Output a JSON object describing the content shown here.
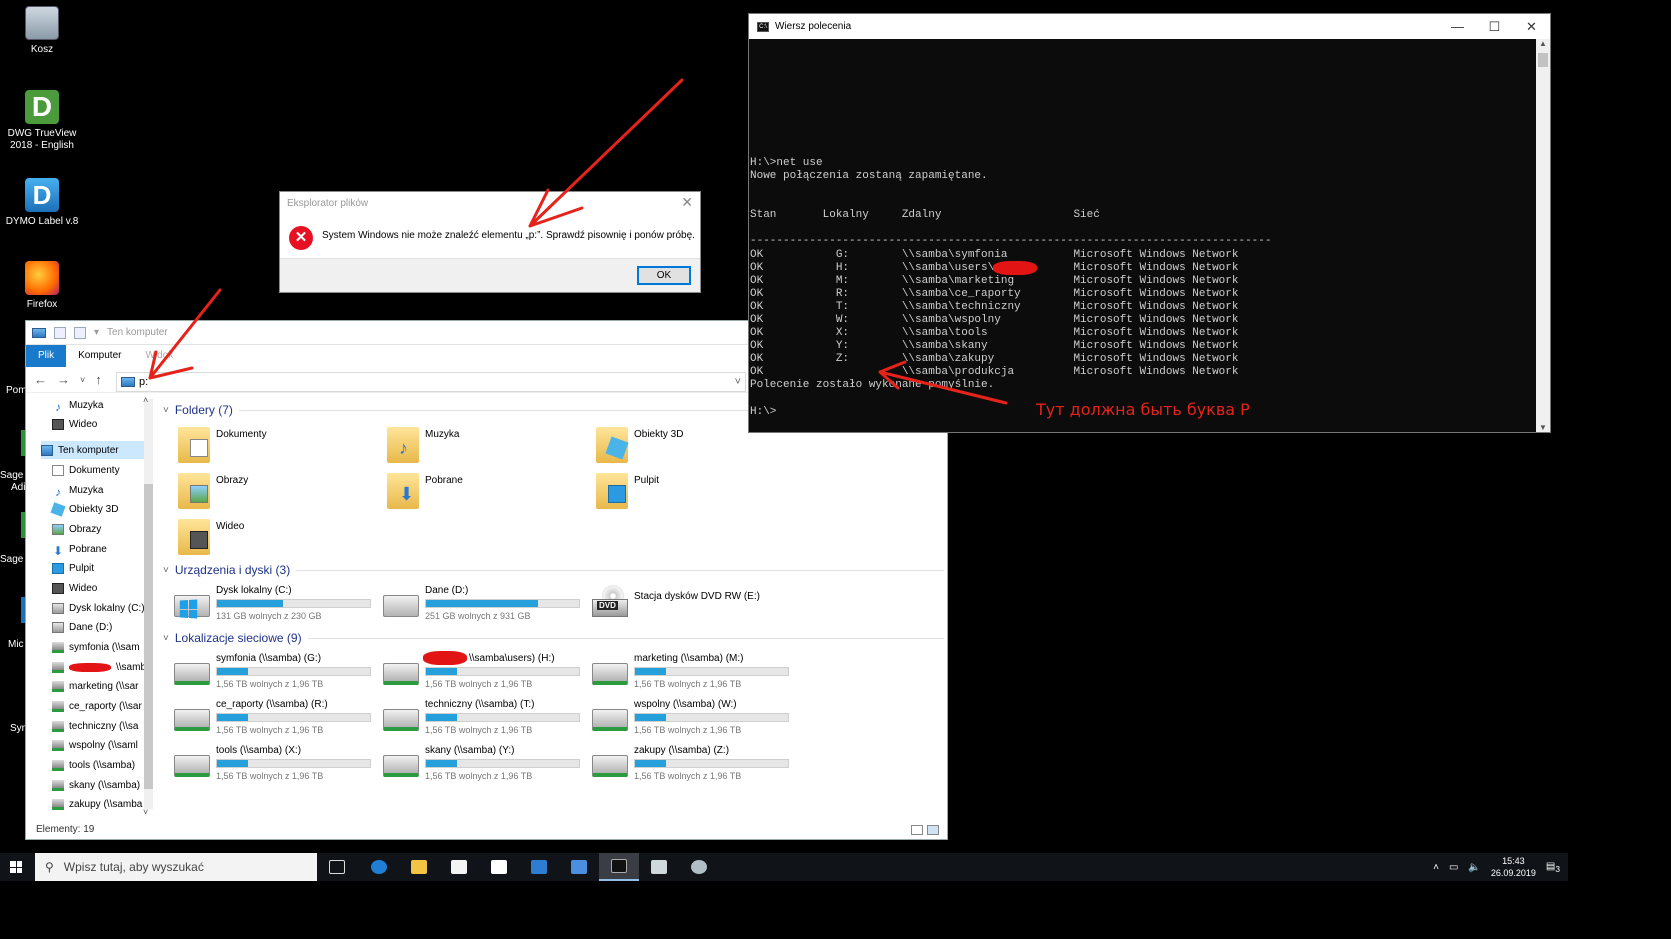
{
  "desktop": {
    "icons": [
      {
        "label": "Kosz",
        "icon": "recycle-bin-icon"
      },
      {
        "label": "DWG TrueView 2018 - English",
        "icon": "dwg-trueview-icon"
      },
      {
        "label": "DYMO Label v.8",
        "icon": "dymo-label-icon"
      },
      {
        "label": "Firefox",
        "icon": "firefox-icon"
      }
    ],
    "edge_labels": [
      "Pom",
      "Sage S",
      "Adi",
      "Sage S",
      "Mic",
      "Syn"
    ]
  },
  "explorer": {
    "title": "Ten komputer",
    "ribbon_tabs": [
      "Plik",
      "Komputer",
      "Widok"
    ],
    "address": "p:",
    "nav": [
      {
        "label": "Muzyka",
        "icon": "music-icon"
      },
      {
        "label": "Wideo",
        "icon": "video-icon"
      },
      {
        "label": "Ten komputer",
        "icon": "pc-icon"
      },
      {
        "label": "Dokumenty",
        "icon": "documents-icon"
      },
      {
        "label": "Muzyka",
        "icon": "music-icon"
      },
      {
        "label": "Obiekty 3D",
        "icon": "objects-3d-icon"
      },
      {
        "label": "Obrazy",
        "icon": "pictures-icon"
      },
      {
        "label": "Pobrane",
        "icon": "downloads-icon"
      },
      {
        "label": "Pulpit",
        "icon": "desktop-icon"
      },
      {
        "label": "Wideo",
        "icon": "video-icon"
      },
      {
        "label": "Dysk lokalny (C:)",
        "icon": "local-disk-icon"
      },
      {
        "label": "Dane (D:)",
        "icon": "local-disk-icon"
      },
      {
        "label": "symfonia (\\\\sam",
        "icon": "network-drive-icon"
      },
      {
        "label": "\\\\samb",
        "icon": "network-drive-icon"
      },
      {
        "label": "marketing (\\\\sar",
        "icon": "network-drive-icon"
      },
      {
        "label": "ce_raporty (\\\\sar",
        "icon": "network-drive-icon"
      },
      {
        "label": "techniczny (\\\\sa",
        "icon": "network-drive-icon"
      },
      {
        "label": "wspolny (\\\\saml",
        "icon": "network-drive-icon"
      },
      {
        "label": "tools (\\\\samba)",
        "icon": "network-drive-icon"
      },
      {
        "label": "skany (\\\\samba)",
        "icon": "network-drive-icon"
      },
      {
        "label": "zakupy (\\\\samba",
        "icon": "network-drive-icon"
      }
    ],
    "sections": {
      "folders": "Foldery (7)",
      "devices": "Urządzenia i dyski (3)",
      "network": "Lokalizacje sieciowe (9)"
    },
    "folders": [
      {
        "label": "Dokumenty",
        "icon": "documents-folder-icon"
      },
      {
        "label": "Muzyka",
        "icon": "music-folder-icon"
      },
      {
        "label": "Obiekty 3D",
        "icon": "objects-3d-folder-icon"
      },
      {
        "label": "Obrazy",
        "icon": "pictures-folder-icon"
      },
      {
        "label": "Pobrane",
        "icon": "downloads-folder-icon"
      },
      {
        "label": "Pulpit",
        "icon": "desktop-folder-icon"
      },
      {
        "label": "Wideo",
        "icon": "videos-folder-icon"
      }
    ],
    "devices": [
      {
        "label": "Dysk lokalny (C:)",
        "free": "131 GB wolnych z 230 GB",
        "used_fraction": 0.43
      },
      {
        "label": "Dane (D:)",
        "free": "251 GB wolnych z 931 GB",
        "used_fraction": 0.73
      },
      {
        "label": "Stacja dysków DVD RW (E:)",
        "dvd_tag": "DVD"
      }
    ],
    "network": [
      {
        "label": "symfonia (\\\\samba) (G:)",
        "free": "1,56 TB wolnych z 1,96 TB",
        "used_fraction": 0.2
      },
      {
        "label": "\\\\samba\\users) (H:)",
        "free": "1,56 TB wolnych z 1,96 TB",
        "used_fraction": 0.2
      },
      {
        "label": "marketing (\\\\samba) (M:)",
        "free": "1,56 TB wolnych z 1,96 TB",
        "used_fraction": 0.2
      },
      {
        "label": "ce_raporty (\\\\samba) (R:)",
        "free": "1,56 TB wolnych z 1,96 TB",
        "used_fraction": 0.2
      },
      {
        "label": "techniczny (\\\\samba) (T:)",
        "free": "1,56 TB wolnych z 1,96 TB",
        "used_fraction": 0.2
      },
      {
        "label": "wspolny (\\\\samba) (W:)",
        "free": "1,56 TB wolnych z 1,96 TB",
        "used_fraction": 0.2
      },
      {
        "label": "tools (\\\\samba) (X:)",
        "free": "1,56 TB wolnych z 1,96 TB",
        "used_fraction": 0.2
      },
      {
        "label": "skany (\\\\samba) (Y:)",
        "free": "1,56 TB wolnych z 1,96 TB",
        "used_fraction": 0.2
      },
      {
        "label": "zakupy (\\\\samba) (Z:)",
        "free": "1,56 TB wolnych z 1,96 TB",
        "used_fraction": 0.2
      }
    ],
    "status": "Elementy: 19"
  },
  "dialog": {
    "title": "Eksplorator plików",
    "message": "System Windows nie może znaleźć elementu „p:”. Sprawdź pisownię i ponów próbę.",
    "ok_label": "OK"
  },
  "cmd": {
    "title": "Wiersz polecenia",
    "lines": [
      "",
      "",
      "",
      "",
      "",
      "",
      "",
      "",
      "",
      "H:\\>net use",
      "Nowe połączenia zostaną zapamiętane.",
      "",
      "",
      "Stan       Lokalny     Zdalny                    Sieć",
      "",
      "-------------------------------------------------------------------------------",
      "OK           G:        \\\\samba\\symfonia          Microsoft Windows Network",
      "OK           H:        \\\\samba\\users\\            Microsoft Windows Network",
      "OK           M:        \\\\samba\\marketing         Microsoft Windows Network",
      "OK           R:        \\\\samba\\ce_raporty        Microsoft Windows Network",
      "OK           T:        \\\\samba\\techniczny        Microsoft Windows Network",
      "OK           W:        \\\\samba\\wspolny           Microsoft Windows Network",
      "OK           X:        \\\\samba\\tools             Microsoft Windows Network",
      "OK           Y:        \\\\samba\\skany             Microsoft Windows Network",
      "OK           Z:        \\\\samba\\zakupy            Microsoft Windows Network",
      "OK                     \\\\samba\\produkcja         Microsoft Windows Network",
      "Polecenie zostało wykonane pomyślnie.",
      "",
      "H:\\>"
    ]
  },
  "annotation": "Тут должна быть буква Р",
  "taskbar": {
    "search_placeholder": "Wpisz tutaj, aby wyszukać",
    "apps": [
      "task-view-icon",
      "edge-icon",
      "file-explorer-icon",
      "store-icon",
      "mail-icon",
      "app-icon",
      "remote-desktop-icon",
      "cmd-icon",
      "network-app-icon",
      "tool-icon"
    ],
    "time": "15:43",
    "date": "26.09.2019",
    "notification_count": "3"
  },
  "colors": {
    "accent": "#0078d7",
    "annotation": "#e5231b",
    "bar": "#26a0da"
  }
}
